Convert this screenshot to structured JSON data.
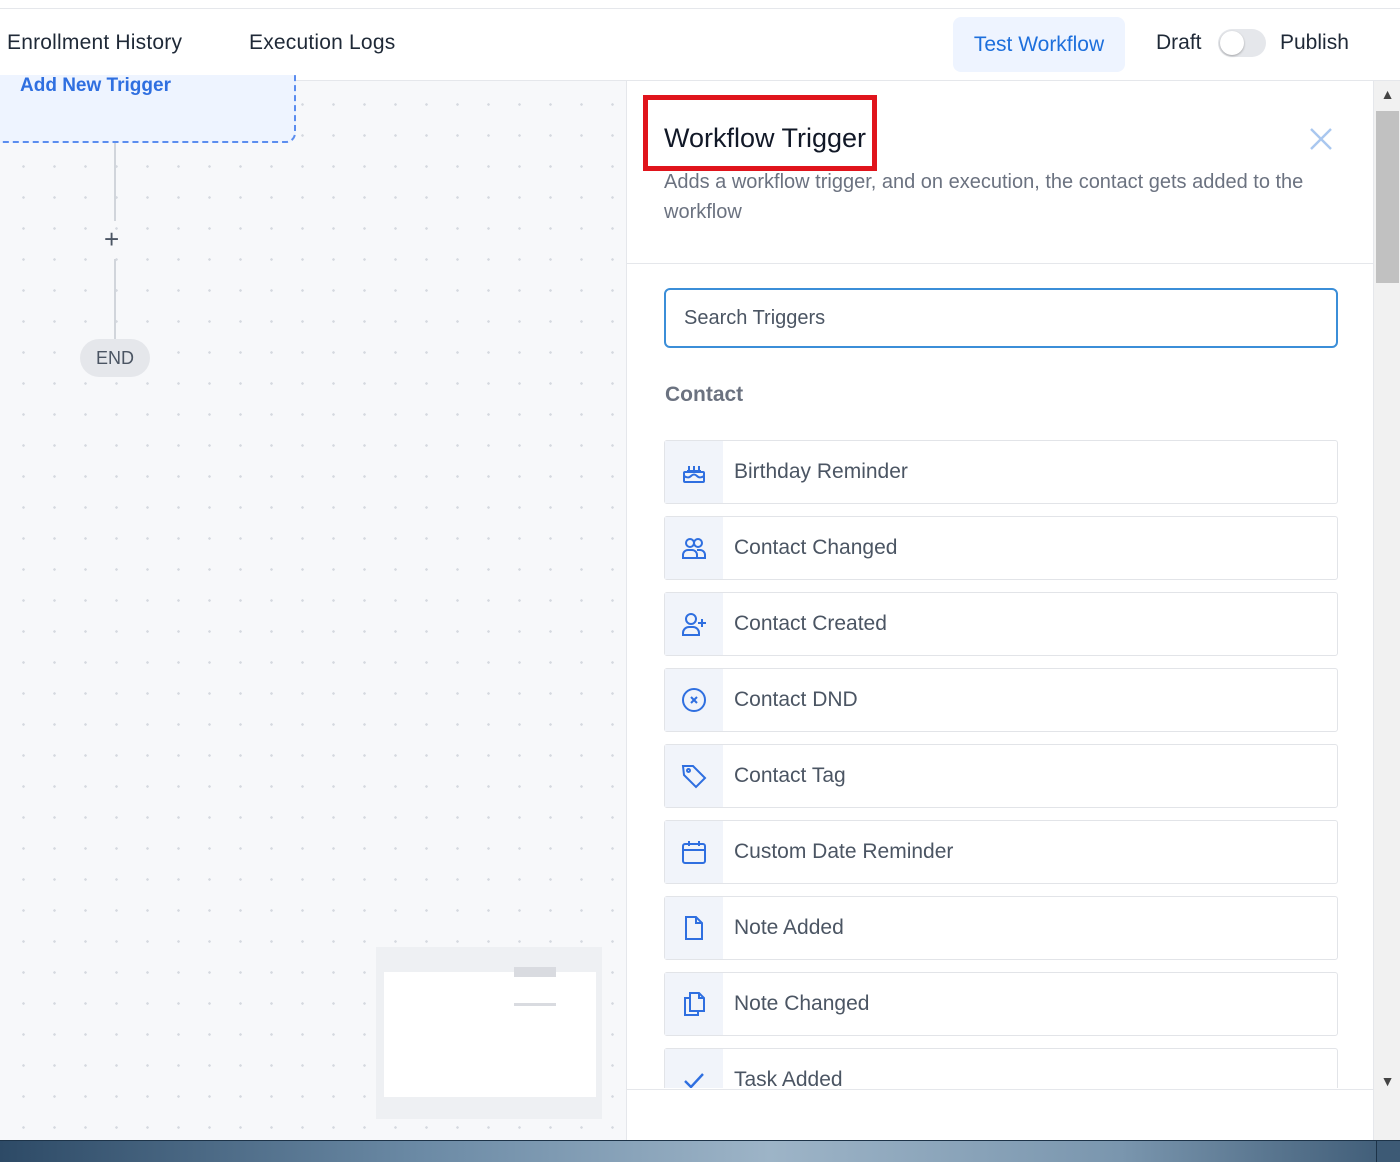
{
  "topbar": {
    "enrollment_history": "Enrollment History",
    "execution_logs": "Execution Logs",
    "test_workflow": "Test Workflow",
    "draft": "Draft",
    "publish": "Publish",
    "publish_toggle_on": false
  },
  "canvas": {
    "trigger_label": "Add New Trigger",
    "add_step": "+",
    "end_label": "END"
  },
  "panel": {
    "title": "Workflow Trigger",
    "description": "Adds a workflow trigger, and on execution, the contact gets added to the workflow",
    "search_placeholder": "Search Triggers",
    "section_title": "Contact",
    "items": [
      {
        "label": "Birthday Reminder",
        "icon": "birthday-cake-icon"
      },
      {
        "label": "Contact Changed",
        "icon": "contacts-icon"
      },
      {
        "label": "Contact Created",
        "icon": "user-plus-icon"
      },
      {
        "label": "Contact DND",
        "icon": "circle-x-icon"
      },
      {
        "label": "Contact Tag",
        "icon": "tag-icon"
      },
      {
        "label": "Custom Date Reminder",
        "icon": "calendar-icon"
      },
      {
        "label": "Note Added",
        "icon": "document-icon"
      },
      {
        "label": "Note Changed",
        "icon": "copy-document-icon"
      },
      {
        "label": "Task Added",
        "icon": "check-icon"
      }
    ]
  },
  "colors": {
    "accent": "#1d6fdc",
    "highlight": "#e0141c",
    "icon": "#2f6fe0"
  }
}
